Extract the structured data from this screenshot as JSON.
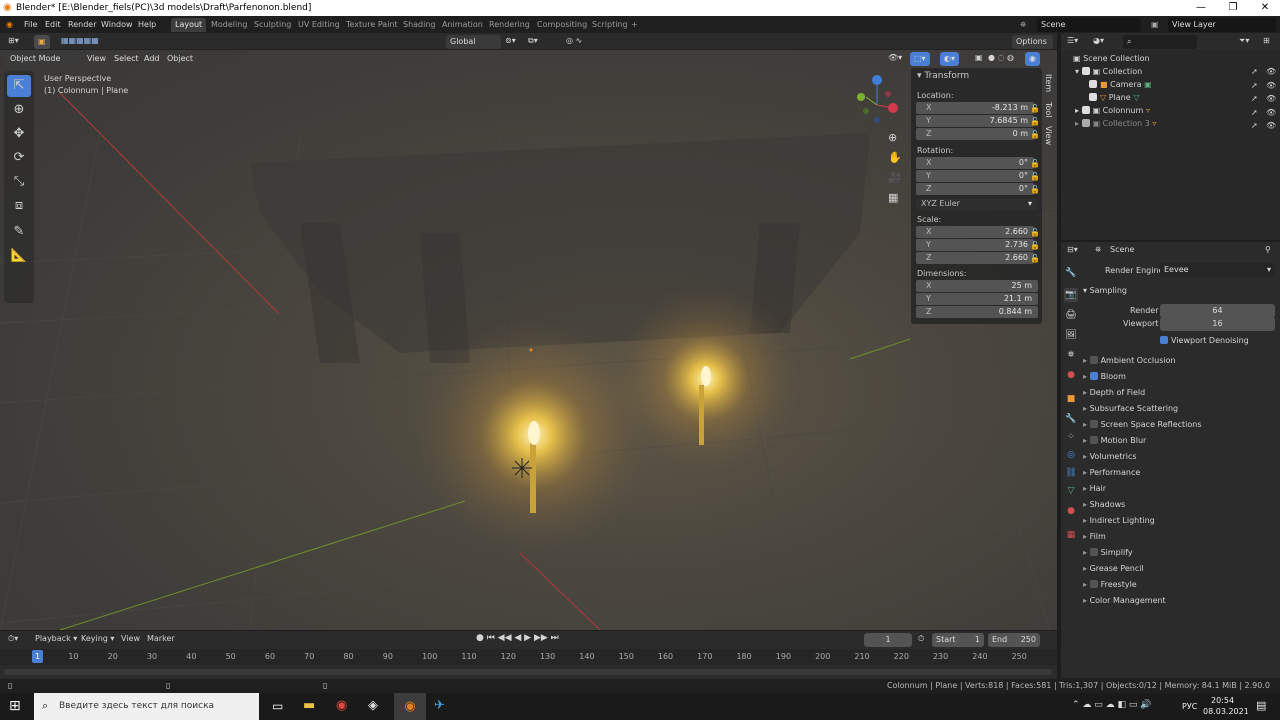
{
  "window": {
    "title": "Blender* [E:\\Blender_fiels(PC)\\3d models\\Draft\\Parfenonon.blend]"
  },
  "menu": {
    "file": "File",
    "edit": "Edit",
    "render": "Render",
    "window": "Window",
    "help": "Help"
  },
  "workspaces": [
    "Layout",
    "Modeling",
    "Sculpting",
    "UV Editing",
    "Texture Paint",
    "Shading",
    "Animation",
    "Rendering",
    "Compositing",
    "Scripting"
  ],
  "scene_selector": {
    "scene": "Scene",
    "view_layer": "View Layer"
  },
  "viewport_header": {
    "transform_orientation": "Global",
    "options": "Options",
    "mode": "Object Mode",
    "view": "View",
    "select": "Select",
    "add": "Add",
    "object": "Object"
  },
  "viewport_info": {
    "perspective": "User Perspective",
    "selection": "(1) Colonnum | Plane"
  },
  "npanel": {
    "title": "Transform",
    "tabs": [
      "Item",
      "Tool",
      "View"
    ],
    "location_label": "Location:",
    "location": [
      {
        "k": "X",
        "v": "-8.213 m"
      },
      {
        "k": "Y",
        "v": "7.6845 m"
      },
      {
        "k": "Z",
        "v": "0 m"
      }
    ],
    "rotation_label": "Rotation:",
    "rotation": [
      {
        "k": "X",
        "v": "0°"
      },
      {
        "k": "Y",
        "v": "0°"
      },
      {
        "k": "Z",
        "v": "0°"
      }
    ],
    "rotation_mode": "XYZ Euler",
    "scale_label": "Scale:",
    "scale": [
      {
        "k": "X",
        "v": "2.660"
      },
      {
        "k": "Y",
        "v": "2.736"
      },
      {
        "k": "Z",
        "v": "2.660"
      }
    ],
    "dimensions_label": "Dimensions:",
    "dimensions": [
      {
        "k": "X",
        "v": "25 m"
      },
      {
        "k": "Y",
        "v": "21.1 m"
      },
      {
        "k": "Z",
        "v": "0.844 m"
      }
    ]
  },
  "outliner": {
    "scene_collection": "Scene Collection",
    "collection": "Collection",
    "camera": "Camera",
    "plane": "Plane",
    "colonnum": "Colonnum",
    "collection3": "Collection 3"
  },
  "properties": {
    "scene": "Scene",
    "render_engine_label": "Render Engine",
    "render_engine": "Eevee",
    "sampling": "Sampling",
    "render_label": "Render",
    "render_value": "64",
    "viewport_label": "Viewport",
    "viewport_value": "16",
    "viewport_denoising": "Viewport Denoising",
    "panels": [
      {
        "label": "Ambient Occlusion",
        "check": "off"
      },
      {
        "label": "Bloom",
        "check": "on"
      },
      {
        "label": "Depth of Field",
        "check": "none"
      },
      {
        "label": "Subsurface Scattering",
        "check": "none"
      },
      {
        "label": "Screen Space Reflections",
        "check": "off"
      },
      {
        "label": "Motion Blur",
        "check": "off"
      },
      {
        "label": "Volumetrics",
        "check": "none"
      },
      {
        "label": "Performance",
        "check": "none"
      },
      {
        "label": "Hair",
        "check": "none"
      },
      {
        "label": "Shadows",
        "check": "none"
      },
      {
        "label": "Indirect Lighting",
        "check": "none"
      },
      {
        "label": "Film",
        "check": "none"
      },
      {
        "label": "Simplify",
        "check": "off"
      },
      {
        "label": "Grease Pencil",
        "check": "none"
      },
      {
        "label": "Freestyle",
        "check": "off"
      },
      {
        "label": "Color Management",
        "check": "none"
      }
    ]
  },
  "timeline": {
    "playback": "Playback",
    "keying": "Keying",
    "view": "View",
    "marker": "Marker",
    "current_frame": "1",
    "start_label": "Start",
    "start": "1",
    "end_label": "End",
    "end": "250",
    "frames": [
      "10",
      "20",
      "30",
      "40",
      "50",
      "60",
      "70",
      "80",
      "90",
      "100",
      "110",
      "120",
      "130",
      "140",
      "150",
      "160",
      "170",
      "180",
      "190",
      "200",
      "210",
      "220",
      "230",
      "240",
      "250"
    ]
  },
  "status": "Colonnum | Plane | Verts:818 | Faces:581 | Tris:1,307 | Objects:0/12 | Memory: 84.1 MiB | 2.90.0",
  "taskbar": {
    "search_placeholder": "Введите здесь текст для поиска",
    "lang": "РУС",
    "time": "20:54",
    "date": "08.03.2021"
  },
  "colors": {
    "accent": "#4a7fd3",
    "workspace_active": "#3d3d3d",
    "glow": "#ffd34a"
  }
}
